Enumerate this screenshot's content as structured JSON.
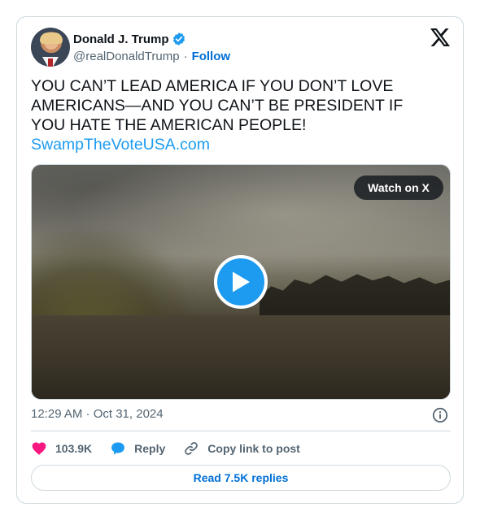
{
  "author": {
    "display_name": "Donald J. Trump",
    "handle": "@realDonaldTrump",
    "verified": true,
    "follow_label": "Follow"
  },
  "tweet": {
    "text": "YOU CAN’T LEAD AMERICA IF YOU DON’T LOVE\nAMERICANS—AND YOU CAN’T BE PRESIDENT IF\nYOU HATE THE AMERICAN PEOPLE!",
    "link": "SwampTheVoteUSA.com",
    "timestamp": "12:29 AM · Oct 31, 2024"
  },
  "media": {
    "watch_label": "Watch on X"
  },
  "actions": {
    "like_count": "103.9K",
    "reply_label": "Reply",
    "copy_label": "Copy link to post"
  },
  "footer": {
    "read_replies_label": "Read 7.5K replies"
  },
  "colors": {
    "accent": "#1d9bf0",
    "link": "#006fd6",
    "like": "#f91880",
    "muted": "#536471",
    "text": "#0f1419",
    "border": "#cfd9de"
  },
  "icons": [
    "verified-badge-icon",
    "x-logo-icon",
    "play-icon",
    "info-icon",
    "heart-icon",
    "reply-bubble-icon",
    "link-icon"
  ]
}
